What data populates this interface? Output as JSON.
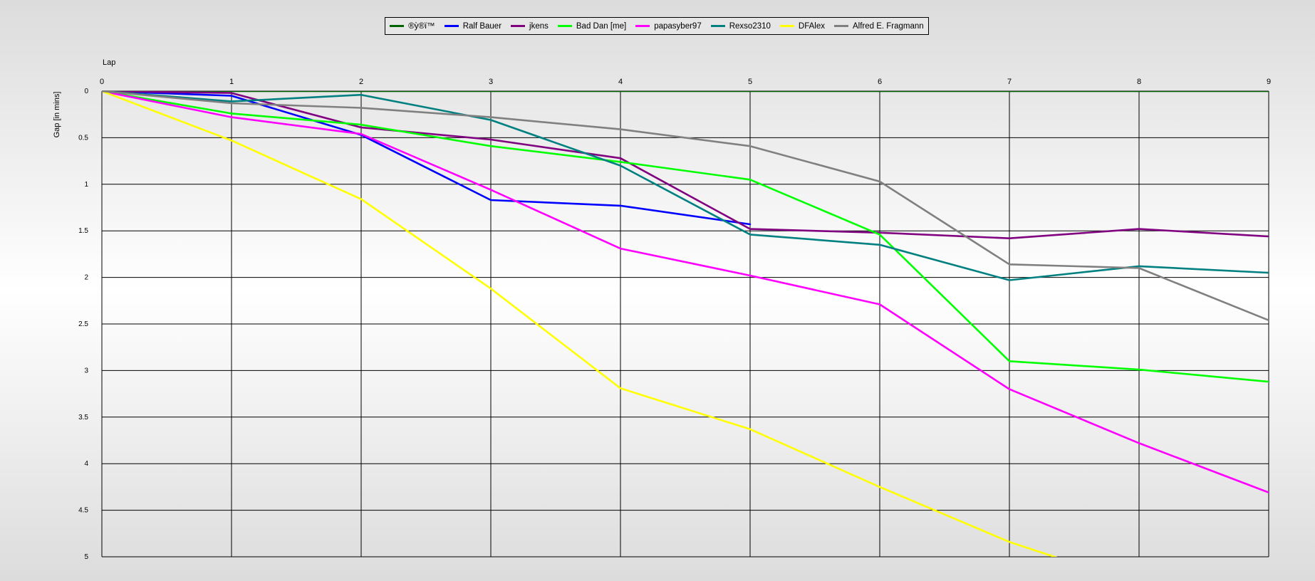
{
  "chart_data": {
    "type": "line",
    "xlabel": "Lap",
    "ylabel": "Gap [in mins]",
    "x": [
      0,
      1,
      2,
      3,
      4,
      5,
      6,
      7,
      8,
      9
    ],
    "xlim": [
      0,
      9
    ],
    "ylim": [
      0,
      5
    ],
    "y_ticks": [
      "0",
      "0.5",
      "1",
      "1.5",
      "2",
      "2.5",
      "3",
      "3.5",
      "4",
      "4.5",
      "5"
    ],
    "y_inverted": true,
    "grid": true,
    "legend_position": "top-center",
    "series": [
      {
        "name": "®ỳ®ï™",
        "color": "#006400",
        "values": [
          0,
          0,
          0,
          0,
          0,
          0,
          0,
          0,
          0,
          0
        ]
      },
      {
        "name": "Ralf Bauer",
        "color": "#0000ff",
        "values": [
          0,
          0.05,
          0.47,
          1.17,
          1.23,
          1.43,
          null,
          null,
          null,
          null
        ]
      },
      {
        "name": "jkens",
        "color": "#800080",
        "values": [
          0,
          0.02,
          0.39,
          0.52,
          0.72,
          1.48,
          1.52,
          1.58,
          1.48,
          1.56
        ]
      },
      {
        "name": "Bad Dan [me]",
        "color": "#00ff00",
        "values": [
          0,
          0.24,
          0.36,
          0.59,
          0.76,
          0.95,
          1.54,
          2.9,
          2.99,
          3.12
        ]
      },
      {
        "name": "papasyber97",
        "color": "#ff00ff",
        "values": [
          0,
          0.28,
          0.46,
          1.06,
          1.69,
          1.98,
          2.29,
          3.2,
          3.78,
          4.31
        ]
      },
      {
        "name": "Rexso2310",
        "color": "#008080",
        "values": [
          0,
          0.11,
          0.04,
          0.31,
          0.8,
          1.54,
          1.65,
          2.03,
          1.88,
          1.95
        ]
      },
      {
        "name": "DFAlex",
        "color": "#ffff00",
        "values": [
          0,
          0.53,
          1.16,
          2.12,
          3.19,
          3.63,
          4.25,
          4.84,
          5.3,
          null
        ]
      },
      {
        "name": "Alfred E. Fragmann",
        "color": "#808080",
        "values": [
          0,
          0.13,
          0.18,
          0.28,
          0.41,
          0.59,
          0.97,
          1.86,
          1.9,
          2.46
        ]
      }
    ]
  }
}
